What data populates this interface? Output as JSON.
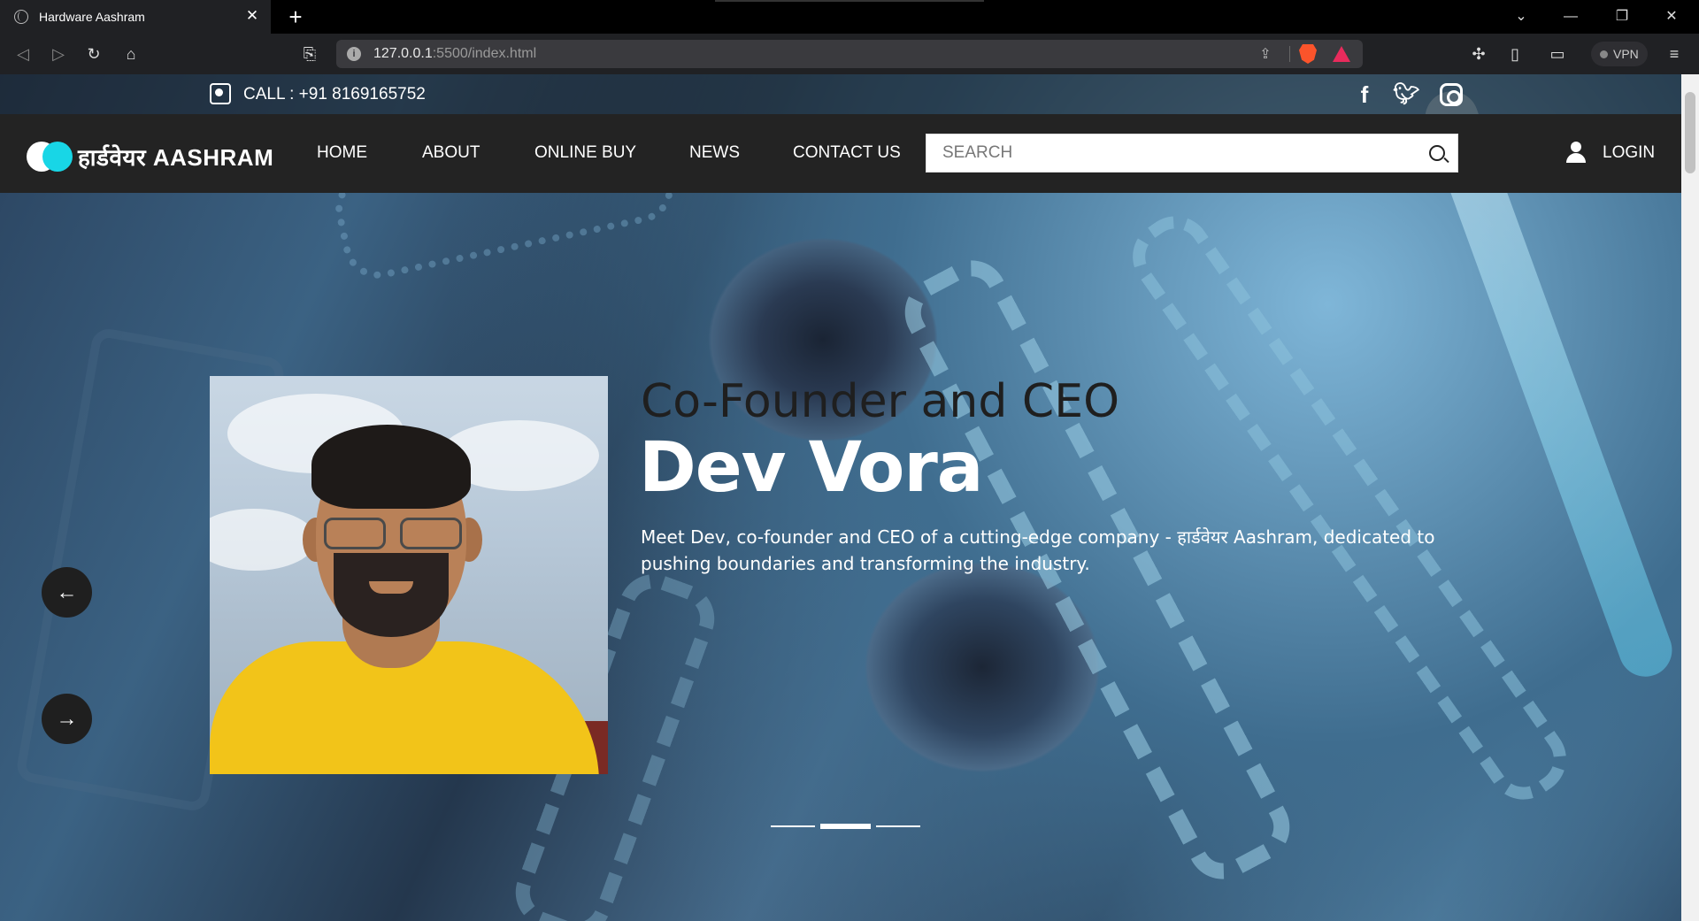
{
  "browser": {
    "tab_title": "Hardware Aashram",
    "url_host": "127.0.0.1",
    "url_path": ":5500/index.html",
    "vpn_label": "VPN"
  },
  "topbar": {
    "call_text": "CALL : +91 8169165752",
    "social": [
      "facebook-icon",
      "twitter-icon",
      "instagram-icon"
    ]
  },
  "nav": {
    "logo_text": "हार्डवेयर AASHRAM",
    "items": [
      "HOME",
      "ABOUT",
      "ONLINE BUY",
      "NEWS",
      "CONTACT US"
    ],
    "search_placeholder": "SEARCH",
    "login_label": "LOGIN"
  },
  "hero": {
    "subtitle": "Co-Founder and CEO",
    "name": "Dev Vora",
    "description": "Meet Dev, co-founder and CEO of a cutting-edge company - हार्डवेयर Aashram, dedicated to pushing boundaries and transforming the industry.",
    "prev_icon": "arrow-left-icon",
    "next_icon": "arrow-right-icon",
    "slides_count": 3,
    "active_slide": 2
  },
  "colors": {
    "nav_bg": "#232323",
    "logo_accent": "#18d6e6",
    "button_bg": "#1f1f1f"
  }
}
